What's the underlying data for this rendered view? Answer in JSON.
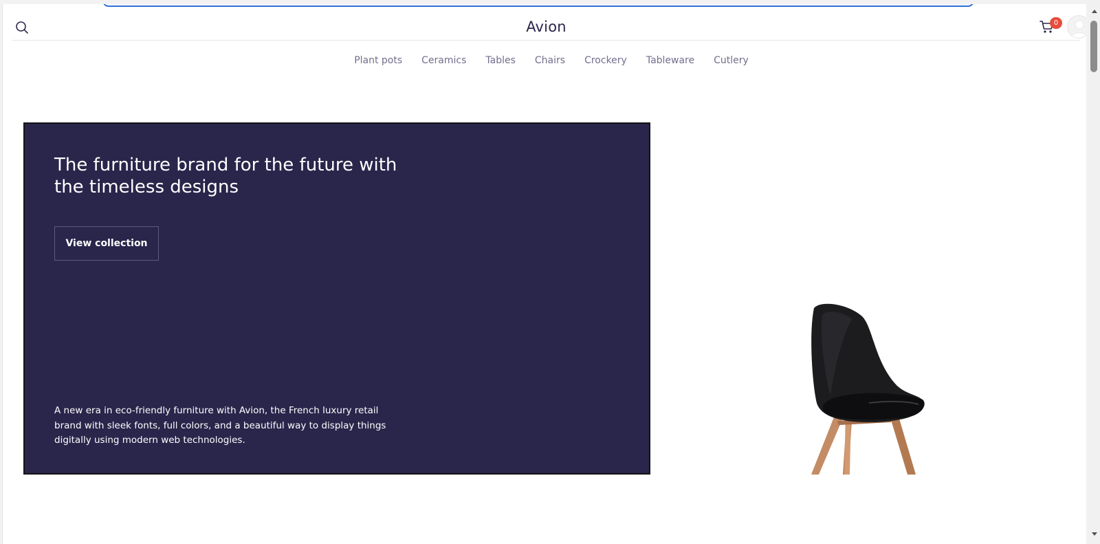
{
  "header": {
    "brand": "Avion",
    "cart_count": "0",
    "icons": {
      "search": "search-icon",
      "cart": "cart-icon",
      "avatar": "user-avatar"
    }
  },
  "nav": {
    "items": [
      {
        "label": "Plant pots"
      },
      {
        "label": "Ceramics"
      },
      {
        "label": "Tables"
      },
      {
        "label": "Chairs"
      },
      {
        "label": "Crockery"
      },
      {
        "label": "Tableware"
      },
      {
        "label": "Cutlery"
      }
    ]
  },
  "hero": {
    "title": "The furniture brand for the future with the timeless designs",
    "button_label": "View collection",
    "description": "A new era in eco-friendly furniture with Avion, the French luxury retail brand with sleek fonts, full colors, and a beautiful way to display things digitally using modern web technologies.",
    "image": "black-chair-image"
  },
  "colors": {
    "hero_bg": "#2a254b",
    "nav_text": "#726e8d",
    "badge": "#e74c3c",
    "focus_ring": "#2f6fd6"
  }
}
